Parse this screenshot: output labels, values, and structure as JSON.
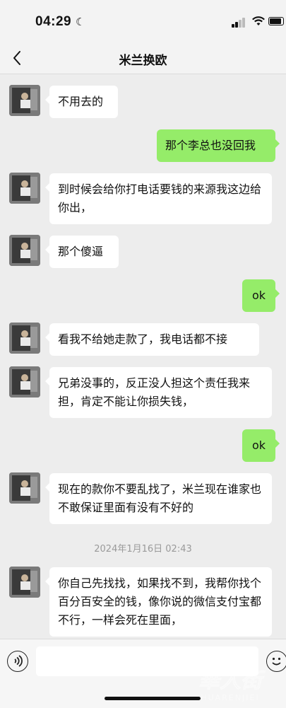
{
  "status_bar": {
    "time": "04:29",
    "moon_icon": "moon-icon"
  },
  "nav": {
    "title": "米兰换欧",
    "back_icon": "chevron-left-icon"
  },
  "messages": [
    {
      "side": "in",
      "text": "不用去的"
    },
    {
      "side": "out",
      "text": "那个李总也没回我"
    },
    {
      "side": "in",
      "text": "到时候会给你打电话要钱的来源我这边给你出，"
    },
    {
      "side": "in",
      "text": "那个傻逼"
    },
    {
      "side": "out",
      "text": "ok"
    },
    {
      "side": "in",
      "text": "看我不给她走款了，我电话都不接"
    },
    {
      "side": "in",
      "text": "兄弟没事的，反正没人担这个责任我来担，肯定不能让你损失钱，"
    },
    {
      "side": "out",
      "text": "ok"
    },
    {
      "side": "in",
      "text": "现在的款你不要乱找了，米兰现在谁家也不敢保证里面有没有不好的"
    },
    {
      "side": "in",
      "text": "你自己先找找，如果找不到，我帮你找个百分百安全的钱，像你说的微信支付宝都不行，一样会死在里面，"
    }
  ],
  "timestamp": "2024年1月16日 02:43",
  "input_bar": {
    "voice_icon": "voice-icon",
    "emoji_icon": "emoji-icon",
    "placeholder": ""
  },
  "watermark": {
    "text": "華人街",
    "subtext": "HUARENJIEI"
  },
  "colors": {
    "bubble_out": "#95ec69",
    "bubble_in": "#ffffff",
    "background": "#ededed"
  }
}
